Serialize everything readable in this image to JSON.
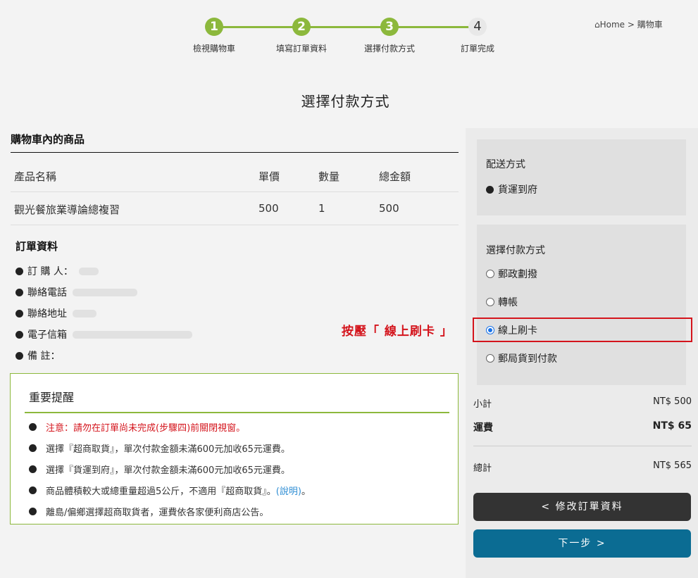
{
  "steps": [
    {
      "num": "1",
      "label": "檢視購物車",
      "state": "done"
    },
    {
      "num": "2",
      "label": "填寫訂單資料",
      "state": "done"
    },
    {
      "num": "3",
      "label": "選擇付款方式",
      "state": "done"
    },
    {
      "num": "4",
      "label": "訂單完成",
      "state": "todo"
    }
  ],
  "breadcrumb": {
    "home": "Home",
    "sep": ">",
    "current": "購物車"
  },
  "page_title": "選擇付款方式",
  "cart": {
    "heading": "購物車內的商品",
    "columns": [
      "產品名稱",
      "單價",
      "數量",
      "總金額"
    ],
    "rows": [
      [
        "觀光餐旅業導論總複習",
        "500",
        "1",
        "500"
      ]
    ]
  },
  "order": {
    "heading": "訂單資料",
    "fields": [
      {
        "label": "訂 購 人："
      },
      {
        "label": "聯絡電話"
      },
      {
        "label": "聯絡地址"
      },
      {
        "label": "電子信箱"
      },
      {
        "label": "備 註："
      }
    ]
  },
  "annotation": "按壓「 線上刷卡 」",
  "notice": {
    "title": "重要提醒",
    "items": [
      "注意：請勿在訂單尚未完成(步驟四)前關閉視窗。",
      "選擇『超商取貨』，單次付款金額未滿600元加收65元運費。",
      "選擇『貨運到府』，單次付款金額未滿600元加收65元運費。",
      "商品體積較大或總重量超過5公斤，不適用『超商取貨』。",
      "離島/偏鄉選擇超商取貨者，運費依各家便利商店公告。"
    ],
    "link_text": "(說明)",
    "link_suffix": "。"
  },
  "shipping": {
    "title": "配送方式",
    "option": "貨運到府"
  },
  "payment": {
    "title": "選擇付款方式",
    "options": [
      "郵政劃撥",
      "轉帳",
      "線上刷卡",
      "郵局貨到付款"
    ],
    "selected": "線上刷卡"
  },
  "summary": {
    "subtotal_label": "小計",
    "subtotal": "NT$ 500",
    "shipping_label": "運費",
    "shipping": "NT$ 65",
    "total_label": "總計",
    "total": "NT$ 565"
  },
  "buttons": {
    "edit": "< 修改訂單資料",
    "next": "下一步 >"
  },
  "colors": {
    "accent": "#8cb83c",
    "alert": "#d4141c",
    "primary_button": "#0b6c93",
    "dark_button": "#333333"
  }
}
